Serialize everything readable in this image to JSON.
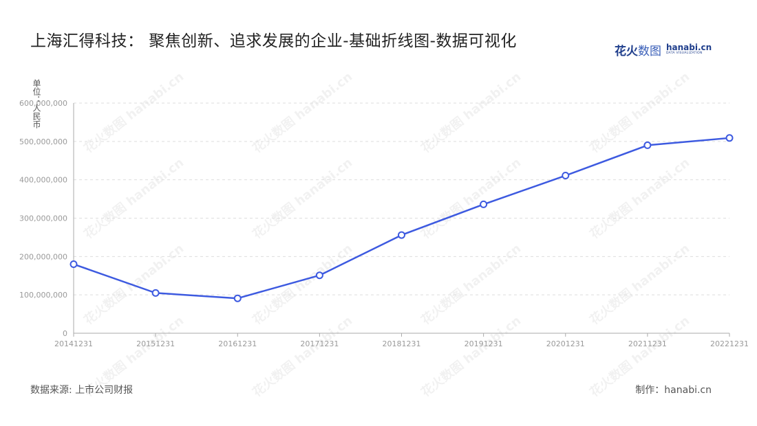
{
  "title": "上海汇得科技： 聚焦创新、追求发展的企业-基础折线图-数据可视化",
  "logo": {
    "cn_bold": "花火",
    "cn_light": "数图",
    "en": "hanabi.cn",
    "sub": "DATA VISUALIZATION"
  },
  "watermark": "花火数图 hanabi.cn",
  "y_unit": "单位：人民币",
  "footer": {
    "source": "数据来源: 上市公司财报",
    "made_by": "制作：hanabi.cn"
  },
  "colors": {
    "line": "#3d5ae0",
    "grid": "#dddddd",
    "axis": "#aaaaaa",
    "tick_text": "#999999"
  },
  "chart_data": {
    "type": "line",
    "x": [
      "20141231",
      "20151231",
      "20161231",
      "20171231",
      "20181231",
      "20191231",
      "20201231",
      "20211231",
      "20221231"
    ],
    "series": [
      {
        "values": [
          180000000,
          105000000,
          91000000,
          151000000,
          256000000,
          336000000,
          411000000,
          490000000,
          509000000
        ]
      }
    ],
    "y_ticks": [
      "0",
      "100,000,000",
      "200,000,000",
      "300,000,000",
      "400,000,000",
      "500,000,000",
      "600,000,000"
    ],
    "ylim": [
      0,
      600000000
    ],
    "grid": true
  }
}
